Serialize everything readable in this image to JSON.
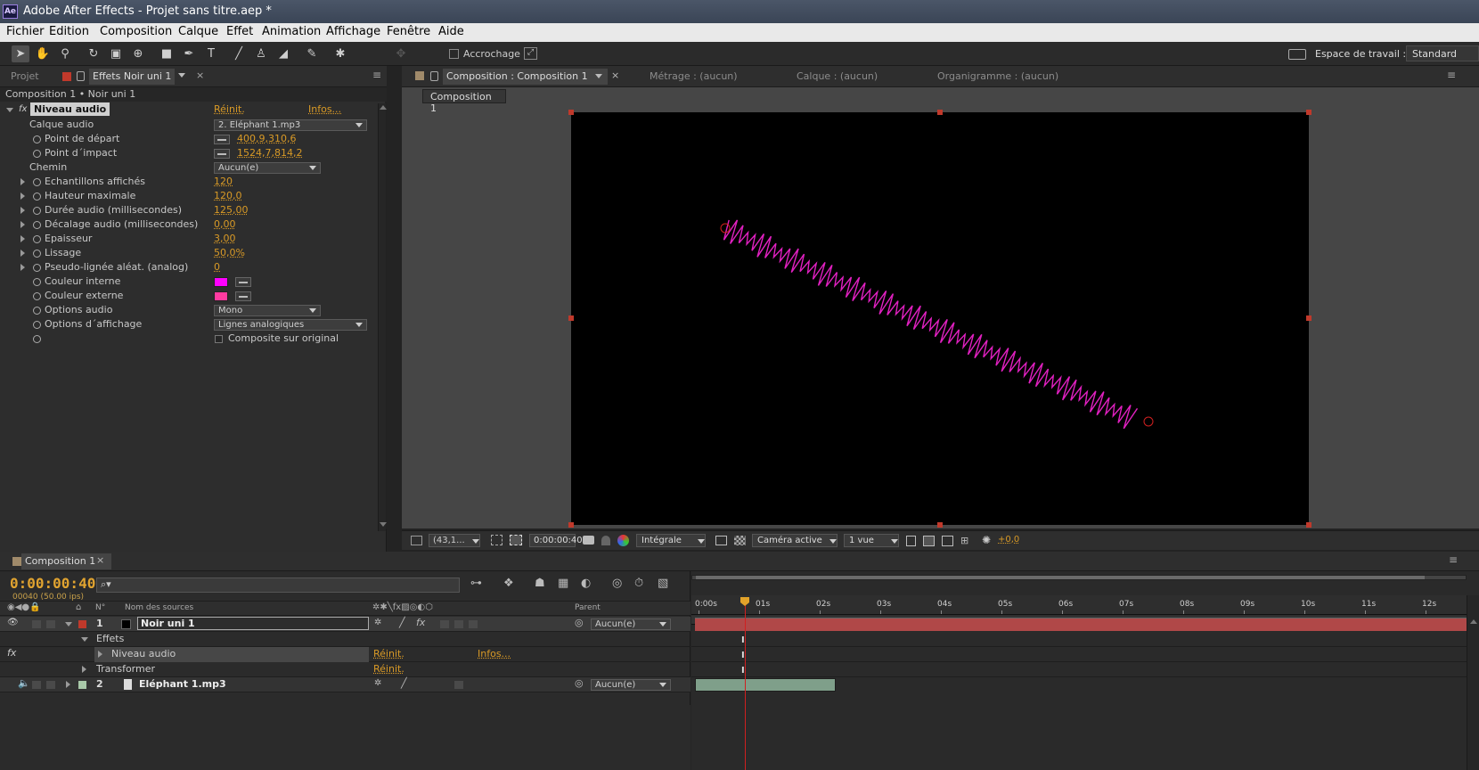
{
  "window": {
    "title": "Adobe After Effects - Projet sans titre.aep *",
    "logo": "Ae"
  },
  "menu": [
    "Fichier",
    "Edition",
    "Composition",
    "Calque",
    "Effet",
    "Animation",
    "Affichage",
    "Fenêtre",
    "Aide"
  ],
  "toolbar": {
    "tools": [
      "selection-tool",
      "hand-tool",
      "zoom-tool",
      "rotate-tool",
      "camera-orbit-tool",
      "pan-behind-tool",
      "rectangle-tool",
      "pen-tool",
      "type-tool",
      "brush-tool",
      "clone-stamp-tool",
      "eraser-tool",
      "roto-brush-tool",
      "puppet-tool"
    ],
    "snapping_label": "Accrochage",
    "workspace_label": "Espace de travail :",
    "workspace_value": "Standard"
  },
  "left_panel": {
    "tab_project": "Projet",
    "tab_effects": "Effets Noir uni 1",
    "breadcrumb": "Composition 1 • Noir uni 1",
    "effect_name": "Niveau audio",
    "reset_label": "Réinit.",
    "info_label": "Infos...",
    "props": [
      {
        "label": "Calque audio",
        "value": "2. Eléphant 1.mp3",
        "kind": "dropdown",
        "indent": 1
      },
      {
        "label": "Point de départ",
        "value": "400,9,310,6",
        "kind": "point",
        "indent": 2,
        "stopwatch": true
      },
      {
        "label": "Point d´impact",
        "value": "1524,7,814,2",
        "kind": "point",
        "indent": 2,
        "stopwatch": true
      },
      {
        "label": "Chemin",
        "value": "Aucun(e)",
        "kind": "dropdown",
        "indent": 1
      },
      {
        "label": "Echantillons affichés",
        "value": "120",
        "kind": "num",
        "indent": 2,
        "stopwatch": true,
        "expand": true
      },
      {
        "label": "Hauteur maximale",
        "value": "120,0",
        "kind": "num",
        "indent": 2,
        "stopwatch": true,
        "expand": true
      },
      {
        "label": "Durée audio (millisecondes)",
        "value": "125,00",
        "kind": "num",
        "indent": 2,
        "stopwatch": true,
        "expand": true
      },
      {
        "label": "Décalage audio (millisecondes)",
        "value": "0,00",
        "kind": "num",
        "indent": 2,
        "stopwatch": true,
        "expand": true
      },
      {
        "label": "Epaisseur",
        "value": "3,00",
        "kind": "num",
        "indent": 2,
        "stopwatch": true,
        "expand": true
      },
      {
        "label": "Lissage",
        "value": "50,0%",
        "kind": "num",
        "indent": 2,
        "stopwatch": true,
        "expand": true
      },
      {
        "label": "Pseudo-lignée aléat. (analog)",
        "value": "0",
        "kind": "num",
        "indent": 2,
        "stopwatch": true,
        "expand": true
      },
      {
        "label": "Couleur interne",
        "value": "#ff00ff",
        "kind": "color",
        "indent": 2,
        "stopwatch": true
      },
      {
        "label": "Couleur externe",
        "value": "#ff3ba0",
        "kind": "color",
        "indent": 2,
        "stopwatch": true
      },
      {
        "label": "Options audio",
        "value": "Mono",
        "kind": "dropdown",
        "indent": 2,
        "stopwatch": true
      },
      {
        "label": "Options d´affichage",
        "value": "Lignes analogiques",
        "kind": "dropdown",
        "indent": 2,
        "stopwatch": true
      },
      {
        "label": "",
        "value": "Composite sur original",
        "kind": "checkbox",
        "indent": 2,
        "stopwatch": true
      }
    ]
  },
  "viewer": {
    "tab_comp": "Composition : Composition 1",
    "tab_footage": "Métrage : (aucun)",
    "tab_layer": "Calque : (aucun)",
    "tab_flowchart": "Organigramme : (aucun)",
    "comp_button": "Composition 1",
    "bottom": {
      "zoom": "(43,1...",
      "timecode": "0:00:00:40",
      "resolution": "Intégrale",
      "camera": "Caméra active",
      "views": "1 vue",
      "exposure": "+0,0"
    },
    "waveform_color": "#e020c0"
  },
  "timeline": {
    "tab": "Composition 1",
    "timecode": "0:00:00:40",
    "frame_info": "00040 (50.00 ips)",
    "search_placeholder": "",
    "col_num": "N°",
    "col_source": "Nom des sources",
    "col_parent": "Parent",
    "ruler": [
      "0:00s",
      "01s",
      "02s",
      "03s",
      "04s",
      "05s",
      "06s",
      "07s",
      "08s",
      "09s",
      "10s",
      "11s",
      "12s"
    ],
    "layer1": {
      "num": "1",
      "name": "Noir uni 1",
      "parent": "Aucun(e)"
    },
    "effects_label": "Effets",
    "effect_row": {
      "name": "Niveau audio",
      "reset": "Réinit.",
      "info": "Infos..."
    },
    "transform_row": {
      "name": "Transformer",
      "reset": "Réinit."
    },
    "layer2": {
      "num": "2",
      "name": "Eléphant 1.mp3",
      "parent": "Aucun(e)"
    },
    "layer1_color": "#b04848",
    "layer2_color": "#7f9f8a"
  }
}
